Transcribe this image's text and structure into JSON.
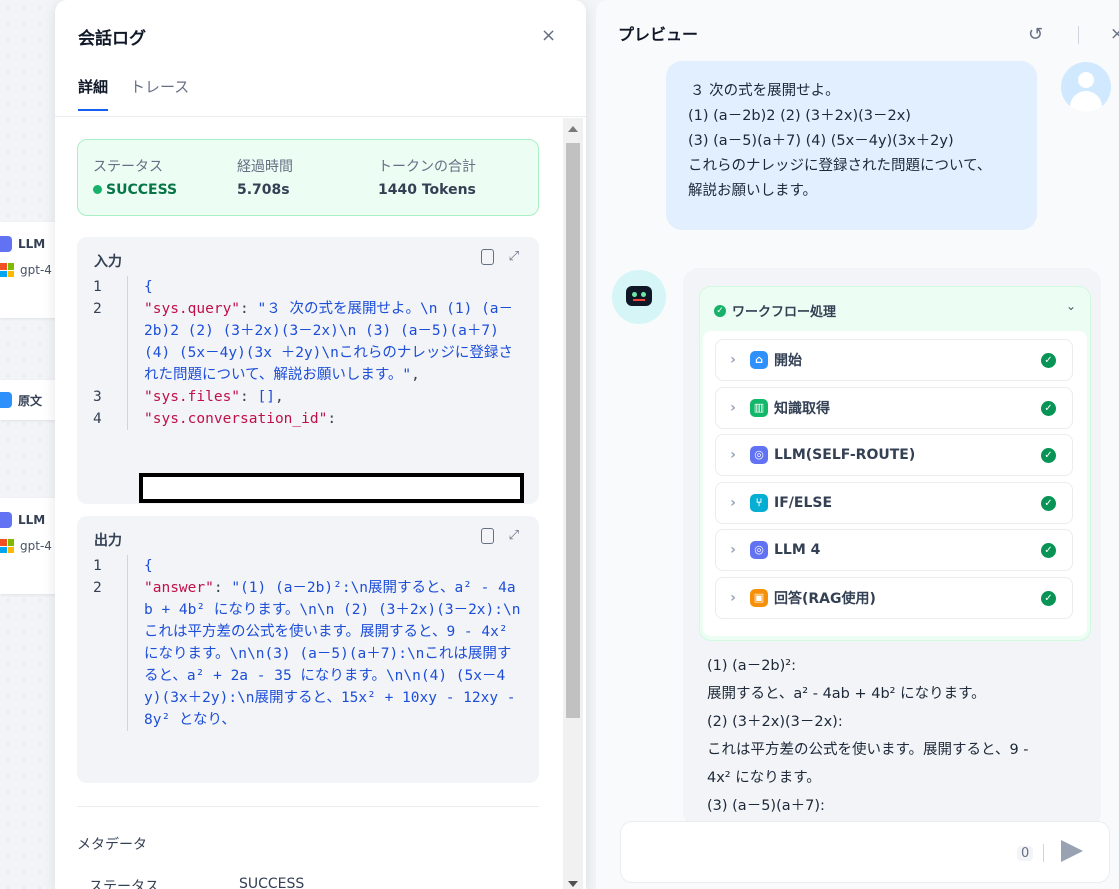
{
  "canvas": {
    "nodes": [
      {
        "label": "LLM",
        "model": "gpt-4"
      },
      {
        "label": "原文"
      },
      {
        "label": "LLM",
        "model": "gpt-4"
      }
    ]
  },
  "log_panel": {
    "title": "会話ログ",
    "close": "×",
    "tabs": [
      "詳細",
      "トレース"
    ],
    "status": {
      "status_label": "ステータス",
      "status_value": "SUCCESS",
      "elapsed_label": "経過時間",
      "elapsed_value": "5.708s",
      "tokens_label": "トークンの合計",
      "tokens_value": "1440 Tokens"
    },
    "input": {
      "label": "入力",
      "lines": [
        {
          "n": "1",
          "parts": [
            {
              "t": "{",
              "c": "s"
            }
          ]
        },
        {
          "n": "2",
          "parts": [
            {
              "t": "\"sys.query\"",
              "c": "k"
            },
            {
              "t": ": ",
              "c": "p"
            },
            {
              "t": "\"３ 次の式を展開せよ。\\n (1) (a－2b)2 (2) (3＋2x)(3－2x)\\n (3) (a－5)(a＋7) (4) (5x－4y)(3x ＋2y)\\nこれらのナレッジに登録された問題について、解説お願いします。\"",
              "c": "s"
            },
            {
              "t": ",",
              "c": "p"
            }
          ]
        },
        {
          "n": "3",
          "parts": [
            {
              "t": "\"sys.files\"",
              "c": "k"
            },
            {
              "t": ": ",
              "c": "p"
            },
            {
              "t": "[]",
              "c": "s"
            },
            {
              "t": ",",
              "c": "p"
            }
          ]
        },
        {
          "n": "4",
          "parts": [
            {
              "t": "\"sys.conversation_id\"",
              "c": "k"
            },
            {
              "t": ":",
              "c": "p"
            }
          ]
        }
      ]
    },
    "output": {
      "label": "出力",
      "lines": [
        {
          "n": "1",
          "parts": [
            {
              "t": "{",
              "c": "s"
            }
          ]
        },
        {
          "n": "2",
          "parts": [
            {
              "t": "\"answer\"",
              "c": "k"
            },
            {
              "t": ": ",
              "c": "p"
            },
            {
              "t": "\"(1) (a－2b)²:\\n展開すると、a² - 4ab + 4b² になります。\\n\\n (2) (3＋2x)(3－2x):\\nこれは平方差の公式を使います。展開すると、9 - 4x² になります。\\n\\n(3) (a－5)(a＋7):\\nこれは展開すると、a² + 2a - 35 になります。\\n\\n(4) (5x－4y)(3x＋2y):\\n展開すると、15x² + 10xy - 12xy - 8y² となり、",
              "c": "s"
            }
          ]
        }
      ]
    },
    "metadata": {
      "title": "メタデータ",
      "status_label": "ステータス",
      "status_value": "SUCCESS"
    }
  },
  "preview": {
    "title": "プレビュー",
    "user_message": [
      "３ 次の式を展開せよ。",
      "(1) (a－2b)2 (2) (3＋2x)(3－2x)",
      "(3) (a－5)(a＋7) (4) (5x－4y)(3x＋2y)",
      "これらのナレッジに登録された問題について、",
      "解説お願いします。"
    ],
    "workflow": {
      "title": "ワークフロー処理",
      "steps": [
        {
          "label": "開始",
          "color": "#2e90fa",
          "icon": "home-icon",
          "glyph": "⌂"
        },
        {
          "label": "知識取得",
          "color": "#12b76a",
          "icon": "book-icon",
          "glyph": "▥"
        },
        {
          "label": "LLM(SELF-ROUTE)",
          "color": "#6172f3",
          "icon": "llm-icon",
          "glyph": "◎"
        },
        {
          "label": "IF/ELSE",
          "color": "#06aed4",
          "icon": "branch-icon",
          "glyph": "⑂"
        },
        {
          "label": "LLM 4",
          "color": "#6172f3",
          "icon": "llm-icon",
          "glyph": "◎"
        },
        {
          "label": "回答(RAG使用)",
          "color": "#f79009",
          "icon": "answer-icon",
          "glyph": "▣"
        }
      ]
    },
    "answer_lines": [
      "(1) (a－2b)²:",
      "展開すると、a² - 4ab + 4b² になります。",
      "(2) (3＋2x)(3－2x):",
      "これは平方差の公式を使います。展開すると、9 -",
      "4x² になります。",
      "(3) (a－5)(a＋7):"
    ],
    "input_count": "0"
  }
}
